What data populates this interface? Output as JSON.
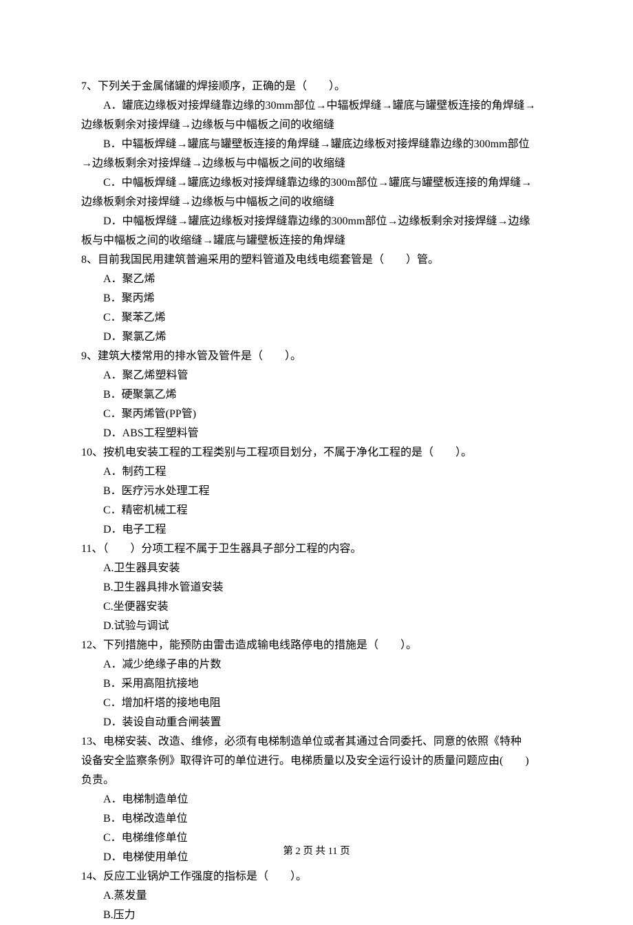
{
  "q7": {
    "stem": "7、下列关于金属储罐的焊接顺序，正确的是（　　）。",
    "A_l1": "A．罐底边缘板对接焊缝靠边缘的30mm部位→中辐板焊缝→罐底与罐壁板连接的角焊缝→",
    "A_l2": "边缘板剩余对接焊缝→边缘板与中幅板之间的收缩缝",
    "B_l1": "B．中辐板焊缝→罐底与罐壁板连接的角焊缝→罐底边缘板对接焊缝靠边缘的300mm部位",
    "B_l2": "→边缘板剩余对接焊缝→边缘板与中幅板之间的收缩缝",
    "C_l1": "C．中幅板焊缝→罐底边缘板对接焊缝靠边缘的300m部位→罐底与罐壁板连接的角焊缝→",
    "C_l2": "边缘板剩余对接焊缝→边缘板与中幅板之间的收缩缝",
    "D_l1": "D．中幅板焊缝→罐底边缘板对接焊缝靠边缘的300mm部位→边缘板剩余对接焊缝→边缘",
    "D_l2": "板与中幅板之间的收缩缝→罐底与罐壁板连接的角焊缝"
  },
  "q8": {
    "stem": "8、目前我国民用建筑普遍采用的塑料管道及电线电缆套管是（　　）管。",
    "A": "A．聚乙烯",
    "B": "B．聚丙烯",
    "C": "C．聚苯乙烯",
    "D": "D．聚氯乙烯"
  },
  "q9": {
    "stem": "9、建筑大楼常用的排水管及管件是（　　）。",
    "A": "A．聚乙烯塑料管",
    "B": "B．硬聚氯乙烯",
    "C": "C．聚丙烯管(PP管)",
    "D": "D．ABS工程塑料管"
  },
  "q10": {
    "stem": "10、按机电安装工程的工程类别与工程项目划分，不属于净化工程的是（　　）。",
    "A": "A．制药工程",
    "B": "B．医疗污水处理工程",
    "C": "C．精密机械工程",
    "D": "D．电子工程"
  },
  "q11": {
    "stem": "11、（　　）分项工程不属于卫生器具子部分工程的内容。",
    "A": "A.卫生器具安装",
    "B": "B.卫生器具排水管道安装",
    "C": "C.坐便器安装",
    "D": "D.试验与调试"
  },
  "q12": {
    "stem": "12、下列措施中，能预防由雷击造成输电线路停电的措施是（　　）。",
    "A": "A．减少绝缘子串的片数",
    "B": "B．采用高阻抗接地",
    "C": "C．增加杆塔的接地电阻",
    "D": "D．装设自动重合闸装置"
  },
  "q13": {
    "stem_l1": "13、电梯安装、改造、维修，必须有电梯制造单位或者其通过合同委托、同意的依照《特种",
    "stem_l2": "设备安全监察条例》取得许可的单位进行。电梯质量以及安全运行设计的质量问题应由(　　)",
    "stem_l3": "负责。",
    "A": "A．电梯制造单位",
    "B": "B．电梯改造单位",
    "C": "C．电梯维修单位",
    "D": "D．电梯使用单位"
  },
  "q14": {
    "stem": "14、反应工业锅炉工作强度的指标是（　　）。",
    "A": "A.蒸发量",
    "B": "B.压力"
  },
  "footer": "第 2 页 共 11 页"
}
